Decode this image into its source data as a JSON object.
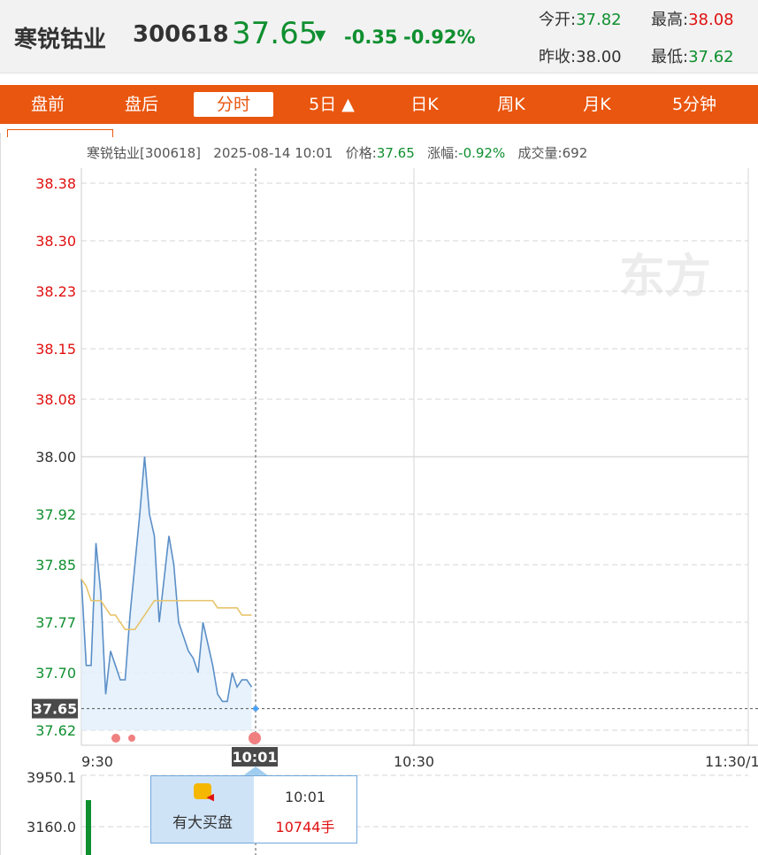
{
  "header": {
    "name": "寒锐钴业",
    "code": "300618",
    "price": "37.65",
    "arrow": "▼",
    "change": "-0.35",
    "change_pct": "-0.92%",
    "open_label": "今开:",
    "open": "37.82",
    "high_label": "最高:",
    "high": "38.08",
    "prev_close_label": "昨收:",
    "prev_close": "38.00",
    "low_label": "最低:",
    "low": "37.62"
  },
  "tabs": [
    "盘前",
    "盘后",
    "分时",
    "5日 ▲",
    "日K",
    "周K",
    "月K",
    "5分钟"
  ],
  "active_tab": 2,
  "info": {
    "name_code": "寒锐钴业[300618]",
    "datetime": "2025-08-14 10:01",
    "price_label": "价格:",
    "price": "37.65",
    "pct_label": "涨幅:",
    "pct": "-0.92%",
    "vol_label": "成交量:",
    "vol": "692"
  },
  "colors": {
    "accent": "#e9560f",
    "up": "#e01010",
    "down": "#0f8f2f",
    "line": "#5b8fc7",
    "avg": "#e8c46a"
  },
  "chart_data": {
    "type": "line",
    "y_ticks": [
      "38.38",
      "38.30",
      "38.23",
      "38.15",
      "38.08",
      "38.00",
      "37.92",
      "37.85",
      "37.77",
      "37.70",
      "37.62"
    ],
    "ylim": [
      37.62,
      38.38
    ],
    "prev_close": 38.0,
    "x_ticks": [
      "9:30",
      "10:30",
      "11:30/1"
    ],
    "crosshair_time": "10:01",
    "crosshair_price": "37.65",
    "series": [
      {
        "values": [
          37.83,
          37.71,
          37.71,
          37.88,
          37.81,
          37.67,
          37.73,
          37.71,
          37.69,
          37.69,
          37.78,
          37.85,
          37.92,
          38.0,
          37.92,
          37.89,
          37.77,
          37.83,
          37.89,
          37.85,
          37.77,
          37.75,
          37.73,
          37.72,
          37.7,
          37.77,
          37.74,
          37.71,
          37.67,
          37.66,
          37.66,
          37.7,
          37.68,
          37.69,
          37.69,
          37.68
        ]
      },
      {
        "values": [
          37.83,
          37.82,
          37.8,
          37.8,
          37.8,
          37.79,
          37.78,
          37.78,
          37.77,
          37.76,
          37.76,
          37.76,
          37.77,
          37.78,
          37.79,
          37.8,
          37.8,
          37.8,
          37.8,
          37.8,
          37.8,
          37.8,
          37.8,
          37.8,
          37.8,
          37.8,
          37.8,
          37.8,
          37.79,
          37.79,
          37.79,
          37.79,
          37.79,
          37.78,
          37.78,
          37.78
        ]
      }
    ],
    "volume_ticks": [
      "3950.1",
      "3160.0"
    ]
  },
  "tooltip": {
    "label": "有大买盘",
    "time": "10:01",
    "volume": "10744手",
    "icon": "big-buy-icon"
  }
}
